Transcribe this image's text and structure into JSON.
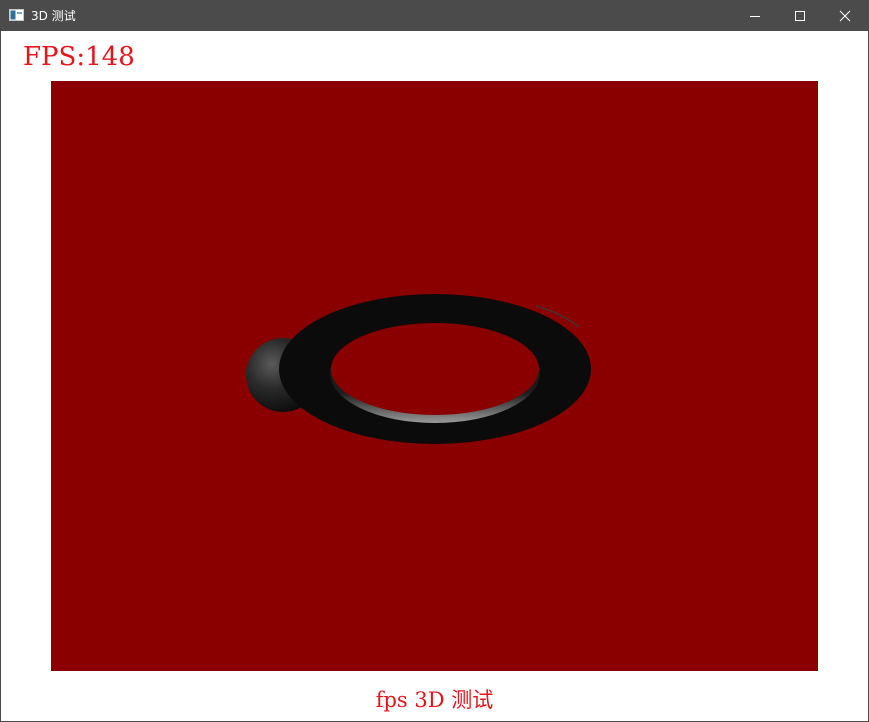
{
  "window": {
    "title": "3D 测试",
    "icon": "app-window-icon",
    "controls": [
      "minimize-icon",
      "maximize-icon",
      "close-icon"
    ]
  },
  "overlay": {
    "fps_text": "FPS:148"
  },
  "viewport": {
    "background_color": "#8a0000",
    "objects": [
      "sphere",
      "torus"
    ]
  },
  "footer": {
    "caption": "fps 3D 测试"
  },
  "colors": {
    "titlebar": "#4b4b4b",
    "text_accent": "#e8141b",
    "viewport_bg": "#8a0000"
  }
}
